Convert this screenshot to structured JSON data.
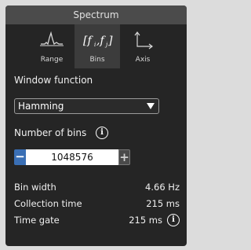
{
  "panel": {
    "title": "Spectrum",
    "tabs": [
      {
        "label": "Range",
        "icon": "spectrum-peak-icon"
      },
      {
        "label": "Bins",
        "icon": "bins-frequency-icon",
        "active": true
      },
      {
        "label": "Axis",
        "icon": "axis-icon"
      }
    ]
  },
  "window_function": {
    "label": "Window function",
    "value": "Hamming"
  },
  "bins": {
    "label": "Number of bins",
    "value": "1048576",
    "minus": "−",
    "plus": "+"
  },
  "stats": {
    "bin_width_label": "Bin width",
    "bin_width_value": "4.66 Hz",
    "collection_time_label": "Collection time",
    "collection_time_value": "215 ms",
    "time_gate_label": "Time gate",
    "time_gate_value": "215 ms"
  },
  "icons": {
    "info": "i"
  },
  "colors": {
    "panel_bg": "#252525",
    "header_bg": "#4b4b4b",
    "active_tab_bg": "#3c3c3c",
    "accent": "#3a6fb5"
  }
}
